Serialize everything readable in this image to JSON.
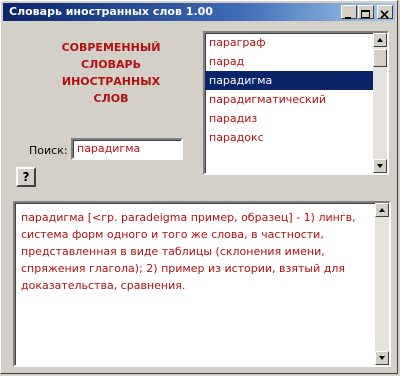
{
  "window": {
    "title": "Словарь иностранных слов 1.00",
    "controls": {
      "minimize": "_",
      "maximize": "□",
      "close": "×"
    }
  },
  "heading": {
    "lines": [
      "СОВРЕМЕННЫЙ",
      "СЛОВАРЬ",
      "ИНОСТРАННЫХ",
      "СЛОВ"
    ]
  },
  "word_list": {
    "items": [
      "параграф",
      "парад",
      "парадигма",
      "парадигматический",
      "парадиз",
      "парадокс"
    ],
    "selected_index": 2
  },
  "search": {
    "label": "Поиск:",
    "value": "парадигма"
  },
  "help_button": {
    "label": "?"
  },
  "definition": {
    "text": "парадигма [<гр. paradeigma пример, образец] - 1) лингв, система форм одного и того же слова, в частности, представленная в виде таблицы (склонения имени, спряжения глагола); 2) пример из истории, взятый для доказательства, сравнения."
  },
  "colors": {
    "accent_text": "#b01010",
    "selection": "#0a246a",
    "window_bg": "#d4d0c8"
  }
}
